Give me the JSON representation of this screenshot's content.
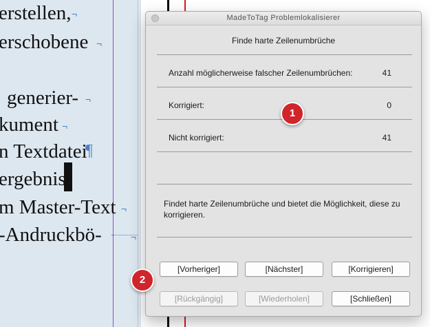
{
  "document": {
    "lines": [
      "erstellen,",
      "erschobene",
      "generier-",
      "kument",
      "n Textdatei",
      "ergebnis-",
      "m Master-Text",
      "-Andruckbö-"
    ],
    "pilcrow": "¶",
    "line_end_mark": "¬"
  },
  "dialog": {
    "title": "MadeToTag Problemlokalisierer",
    "heading": "Finde harte Zeilenumbrüche",
    "rows": [
      {
        "label": "Anzahl möglicherweise falscher Zeilenumbrüchen:",
        "value": "41"
      },
      {
        "label": "Korrigiert:",
        "value": "0"
      },
      {
        "label": "Nicht korrigiert:",
        "value": "41"
      }
    ],
    "description": "Findet harte Zeilenumbrüche und bietet die Möglichkeit, diese zu korrigieren.",
    "buttons": {
      "previous": "[Vorheriger]",
      "next": "[Nächster]",
      "correct": "[Korrigieren]",
      "undo": "[Rückgängig]",
      "redo": "[Wiederholen]",
      "close": "[Schließen]"
    }
  },
  "callouts": {
    "one": "1",
    "two": "2"
  },
  "colors": {
    "callout": "#d0252b",
    "guide": "#8a4fc7",
    "hidden_chars": "#4a7fc7"
  }
}
